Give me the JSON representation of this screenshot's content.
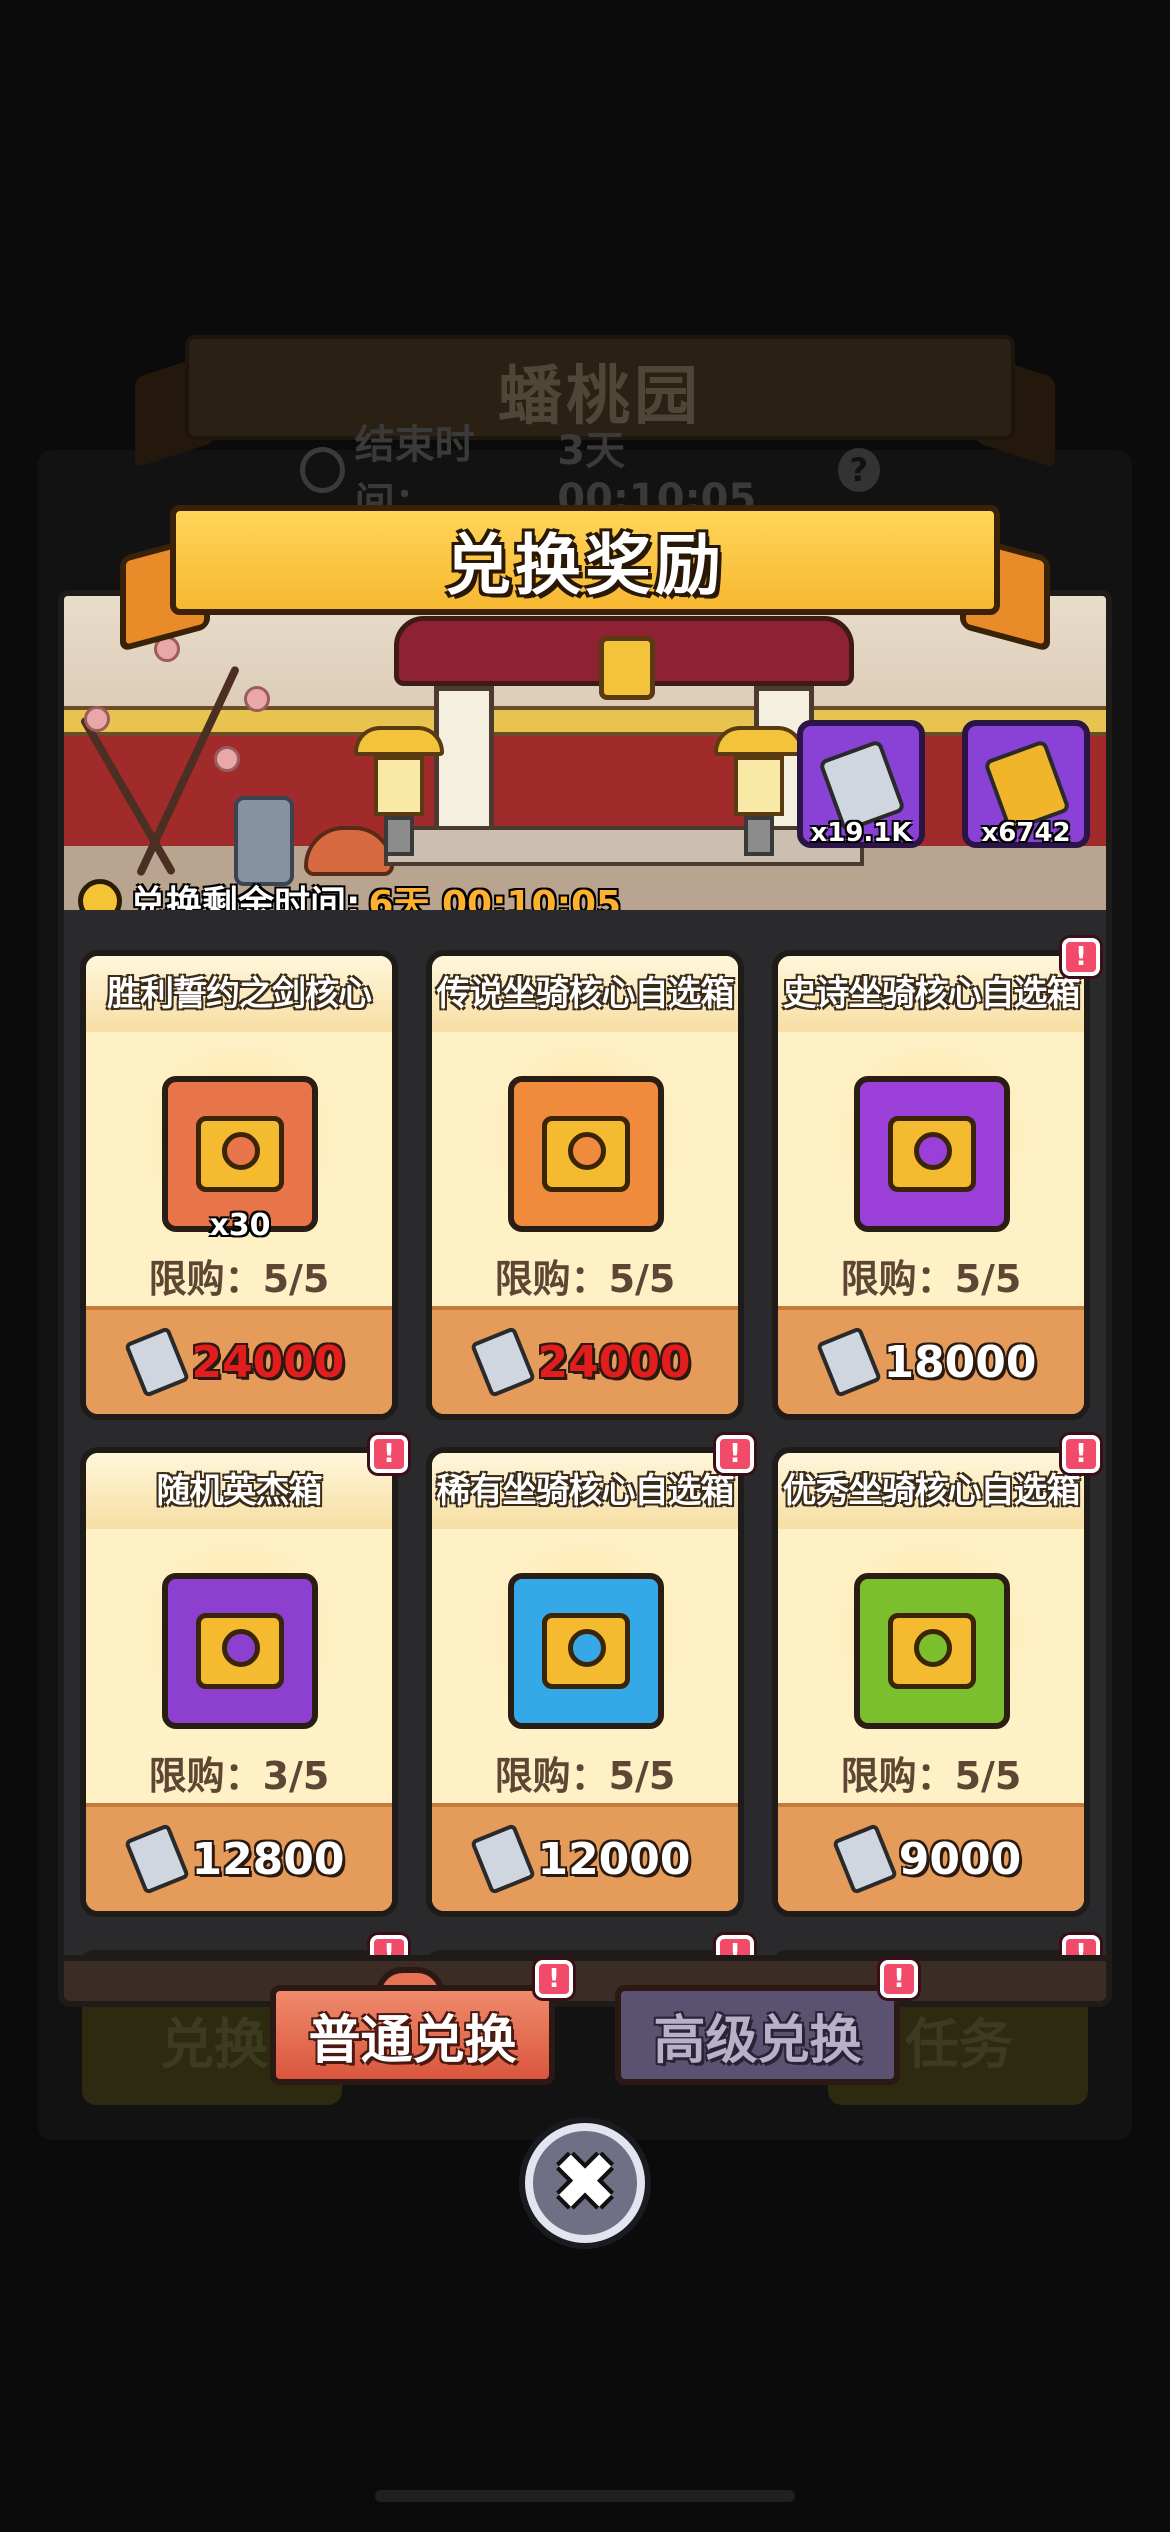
{
  "background": {
    "banner_title": "蟠桃园",
    "timer_label": "结束时间：",
    "timer_value": "3天 00:10:05",
    "help_icon": "?",
    "tab_left": "兑换",
    "tab_right": "任务"
  },
  "modal": {
    "title": "兑换奖励",
    "remaining_label": "兑换剩余时间:",
    "remaining_value": "6天 00:10:05"
  },
  "currencies": [
    {
      "icon": "silver-ticket-icon",
      "amount": "x19.1K",
      "color": "#cfd6df"
    },
    {
      "icon": "gold-ticket-icon",
      "amount": "x6742",
      "color": "#f0b52a"
    }
  ],
  "items": [
    {
      "name": "胜利誓约之剑核心",
      "qty": "x30",
      "limit": "限购：5/5",
      "price": "24000",
      "price_color": "red",
      "icon": "sword-core-icon",
      "icon_color": "#e8744a",
      "alert": false
    },
    {
      "name": "传说坐骑核心自选箱",
      "qty": "",
      "limit": "限购：5/5",
      "price": "24000",
      "price_color": "red",
      "icon": "legendary-chest-icon",
      "icon_color": "#f08a3c",
      "alert": false
    },
    {
      "name": "史诗坐骑核心自选箱",
      "qty": "",
      "limit": "限购：5/5",
      "price": "18000",
      "price_color": "white",
      "icon": "epic-chest-icon",
      "icon_color": "#9a3fd8",
      "alert": true
    },
    {
      "name": "随机英杰箱",
      "qty": "",
      "limit": "限购：3/5",
      "price": "12800",
      "price_color": "white",
      "icon": "random-hero-chest-icon",
      "icon_color": "#8d3fd0",
      "alert": true
    },
    {
      "name": "稀有坐骑核心自选箱",
      "qty": "",
      "limit": "限购：5/5",
      "price": "12000",
      "price_color": "white",
      "icon": "rare-chest-icon",
      "icon_color": "#35a8e8",
      "alert": true
    },
    {
      "name": "优秀坐骑核心自选箱",
      "qty": "",
      "limit": "限购：5/5",
      "price": "9000",
      "price_color": "white",
      "icon": "excellent-chest-icon",
      "icon_color": "#7cbf2e",
      "alert": true
    }
  ],
  "tabs": {
    "normal": "普通兑换",
    "advanced": "高级兑换"
  },
  "alert_symbol": "!",
  "close_symbol": "✖"
}
